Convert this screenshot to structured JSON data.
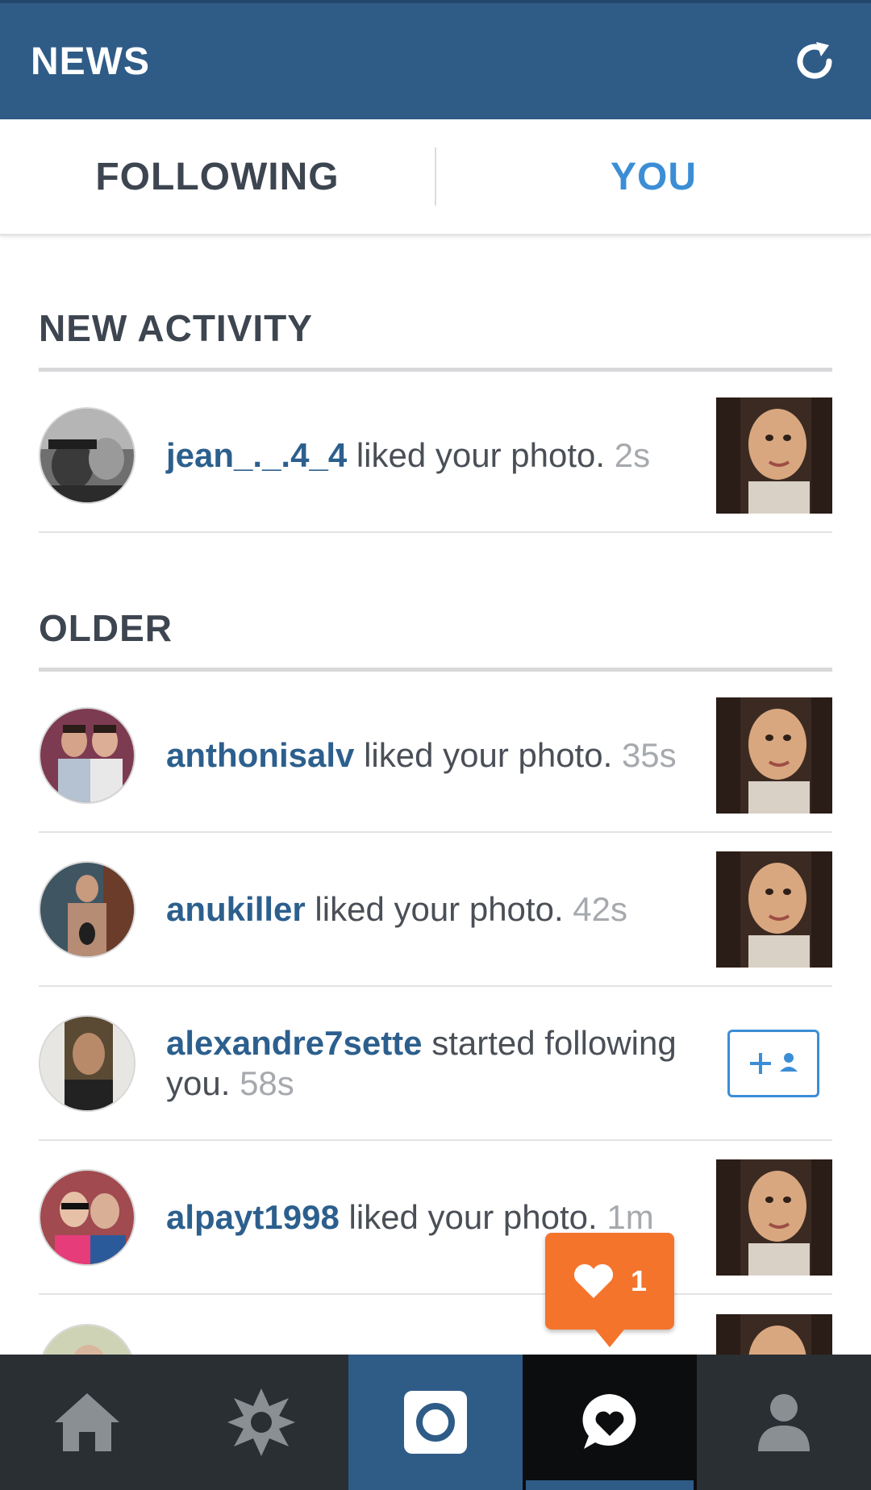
{
  "header": {
    "title": "NEWS",
    "refresh_icon": "refresh-icon"
  },
  "tabs": [
    {
      "label": "FOLLOWING",
      "active": false
    },
    {
      "label": "YOU",
      "active": true
    }
  ],
  "sections": {
    "new_activity": "NEW ACTIVITY",
    "older": "OLDER"
  },
  "activity": [
    {
      "user": "jean_._.4_4",
      "action": "liked your photo.",
      "time": "2s"
    },
    {
      "user": "anthonisalv",
      "action": "liked your photo.",
      "time": "35s"
    },
    {
      "user": "anukiller",
      "action": "liked your photo.",
      "time": "42s"
    },
    {
      "user": "alexandre7sette",
      "action": "started following you.",
      "time": "58s"
    },
    {
      "user": "alpayt1998",
      "action": "liked your photo.",
      "time": "1m"
    }
  ],
  "notification": {
    "count": "1",
    "icon": "heart-icon"
  },
  "colors": {
    "header_bg": "#2f5c87",
    "tab_active": "#3b8ed6",
    "username": "#2c5f8d",
    "notification": "#f4742c",
    "nav_bg": "#2a2f34"
  },
  "bottom_nav": [
    {
      "name": "home-icon"
    },
    {
      "name": "explore-icon"
    },
    {
      "name": "camera-icon"
    },
    {
      "name": "activity-icon",
      "active": true
    },
    {
      "name": "profile-icon"
    }
  ]
}
